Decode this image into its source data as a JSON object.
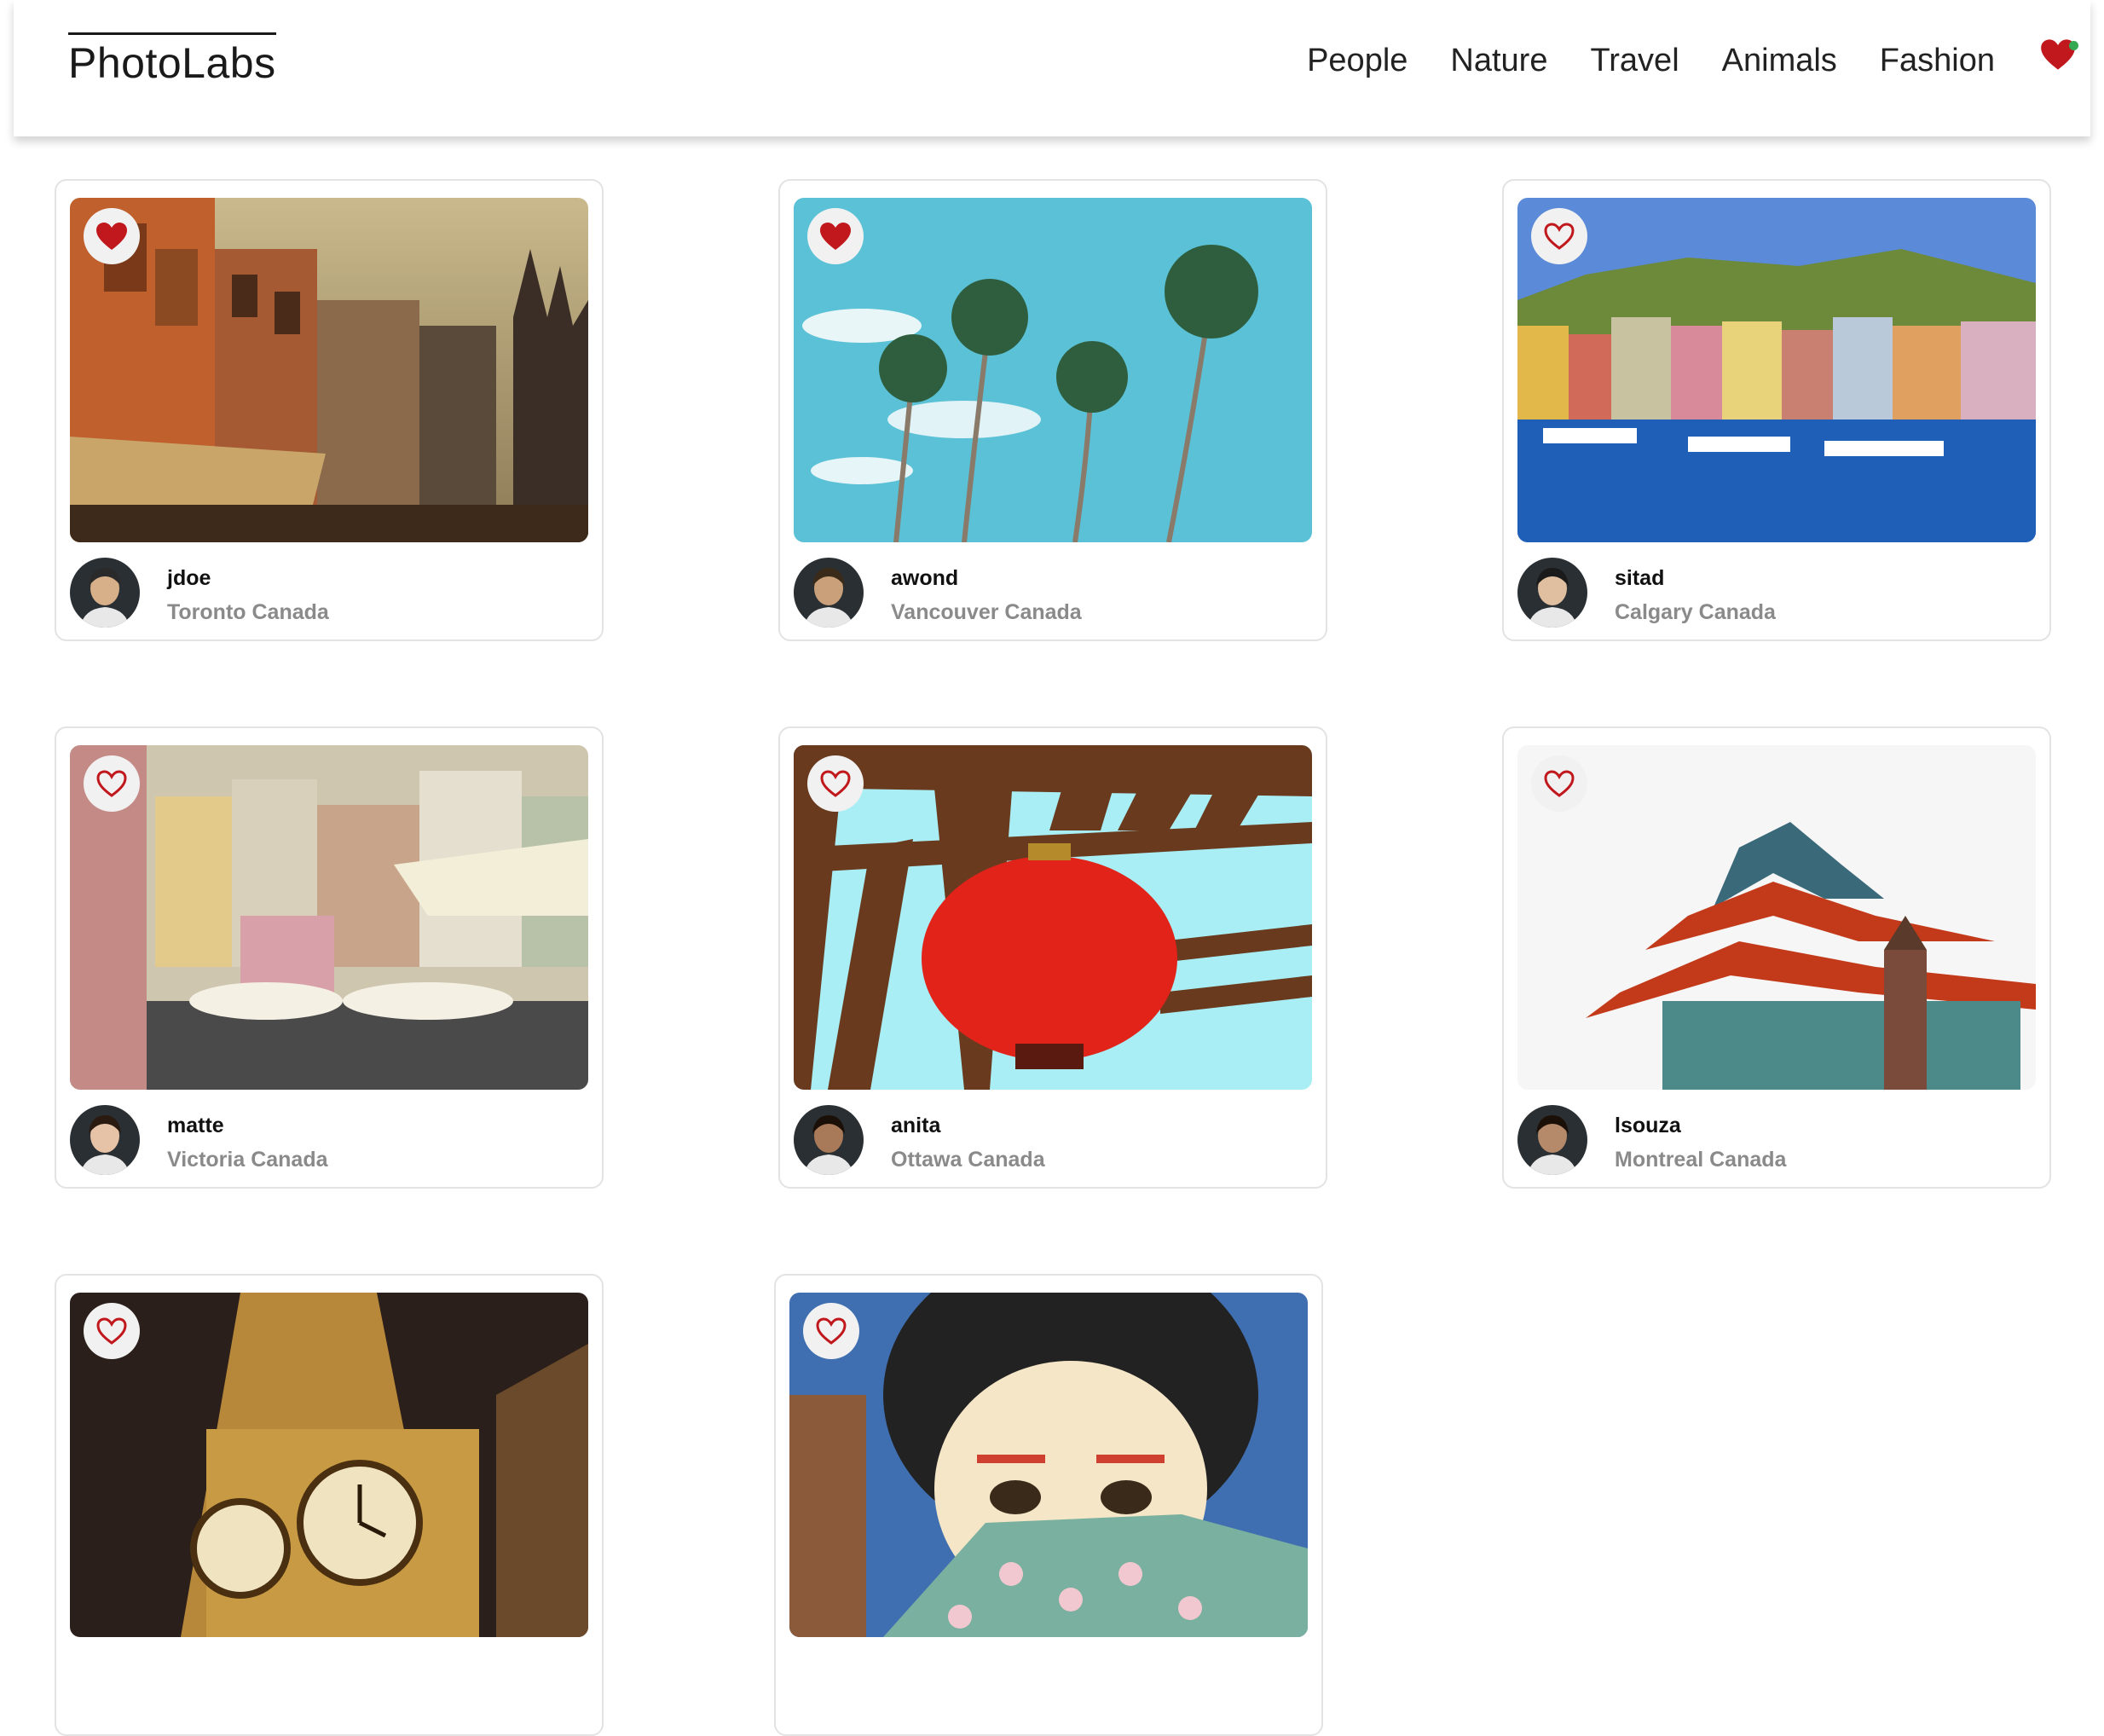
{
  "brand": "PhotoLabs",
  "topics": [
    "People",
    "Nature",
    "Travel",
    "Animals",
    "Fashion"
  ],
  "nav_fav": {
    "icon": "heart-icon",
    "color": "#c0181c",
    "has_notification": true
  },
  "colors": {
    "heart": "#c0181c",
    "location": "#8a8a8a"
  },
  "photos": [
    {
      "username": "jdoe",
      "location": "Toronto Canada",
      "liked": true,
      "scene": "old-buildings"
    },
    {
      "username": "awond",
      "location": "Vancouver Canada",
      "liked": true,
      "scene": "palm-trees"
    },
    {
      "username": "sitad",
      "location": "Calgary Canada",
      "liked": false,
      "scene": "harbor-town"
    },
    {
      "username": "matte",
      "location": "Victoria Canada",
      "liked": false,
      "scene": "colorful-village"
    },
    {
      "username": "anita",
      "location": "Ottawa Canada",
      "liked": false,
      "scene": "red-lantern"
    },
    {
      "username": "lsouza",
      "location": "Montreal Canada",
      "liked": false,
      "scene": "pagoda-roof"
    },
    {
      "username": "",
      "location": "",
      "liked": false,
      "scene": "clock-tower"
    },
    {
      "username": "",
      "location": "",
      "liked": false,
      "scene": "geisha-mural"
    }
  ]
}
